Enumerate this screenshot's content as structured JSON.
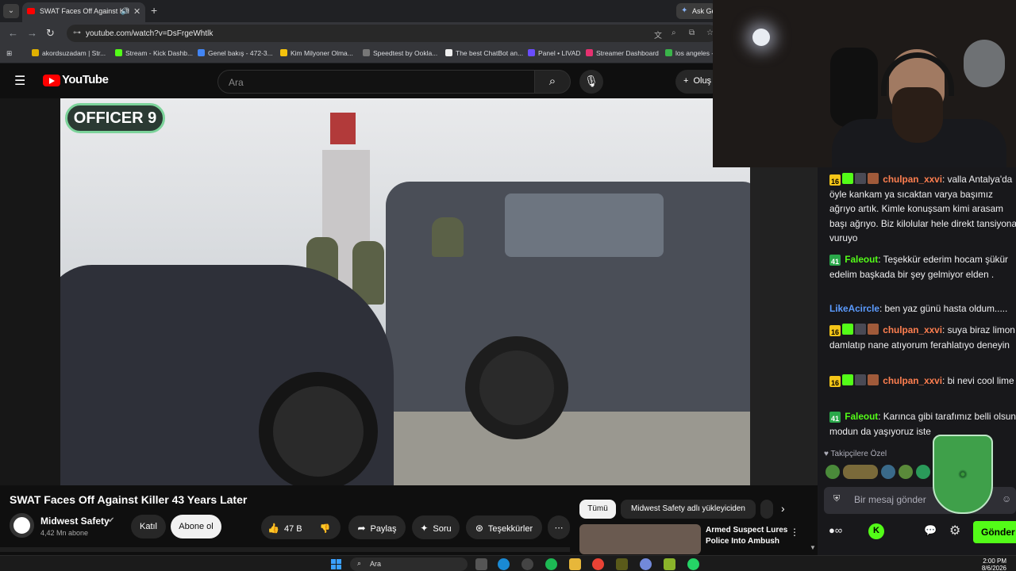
{
  "browser": {
    "tab_title": "SWAT Faces Off Against Kill",
    "ask_label": "Ask Ge",
    "url": "youtube.com/watch?v=DsFrgeWhtlk",
    "bookmarks": [
      "akordsuzadam | Str...",
      "Stream - Kick Dashb...",
      "Genel bakış - 472-3...",
      "Kim Milyoner Olma...",
      "Speedtest by Ookla...",
      "The best ChatBot an...",
      "Panel • LIVAD",
      "Streamer Dashboard",
      "los angeles -"
    ]
  },
  "youtube": {
    "logo_text": "YouTube",
    "search_placeholder": "Ara",
    "create_label": "Oluş",
    "officer_label": "OFFICER 9",
    "video_title": "SWAT Faces Off Against Killer 43 Years Later",
    "channel_name": "Midwest Safety",
    "subscribers": "4,42 Mn abone",
    "join_label": "Katıl",
    "subscribe_label": "Abone ol",
    "like_count": "47 B",
    "share_label": "Paylaş",
    "ask_label": "Soru",
    "thanks_label": "Teşekkürler",
    "chips": [
      "Tümü",
      "Midwest Safety adlı yükleyiciden"
    ],
    "rec_title": "Armed Suspect Lures Police Into Ambush"
  },
  "chat": {
    "messages": [
      {
        "user": "chulpan_xxvi",
        "color": "#ff7f50",
        "sub": "16",
        "text": ": valla Antalya'da öyle kankam ya sıcaktan varya başımız ağrıyo artık. Kimle konuşsam kimi arasam başı ağrıyo. Biz kilolular hele direkt tansiyona vuruyo"
      },
      {
        "user": "Faleout",
        "color": "#53fc18",
        "sub": "41",
        "text": ": Teşekkür ederim hocam şükür edelim başkada bir şey gelmiyor elden ."
      },
      {
        "user": "LikeAcircle",
        "color": "#5b9bff",
        "sub": "",
        "text": ": ben yaz günü hasta oldum....."
      },
      {
        "user": "chulpan_xxvi",
        "color": "#ff7f50",
        "sub": "16",
        "text": ": suya biraz limon damlatıp nane atıyorum ferahlatıyo deneyin"
      },
      {
        "user": "chulpan_xxvi",
        "color": "#ff7f50",
        "sub": "16",
        "text": ": bi nevi cool lime"
      },
      {
        "user": "Faleout",
        "color": "#53fc18",
        "sub": "41",
        "text": ": Karınca gibi tarafımız belli olsun modun da yaşıyoruz iste"
      }
    ],
    "follow_label": "Takipçilere Özel",
    "input_placeholder": "Bir mesaj gönder",
    "send_label": "Gönder"
  },
  "taskbar": {
    "search_label": "Ara",
    "time": "2:00 PM",
    "date": "8/6/2026"
  }
}
